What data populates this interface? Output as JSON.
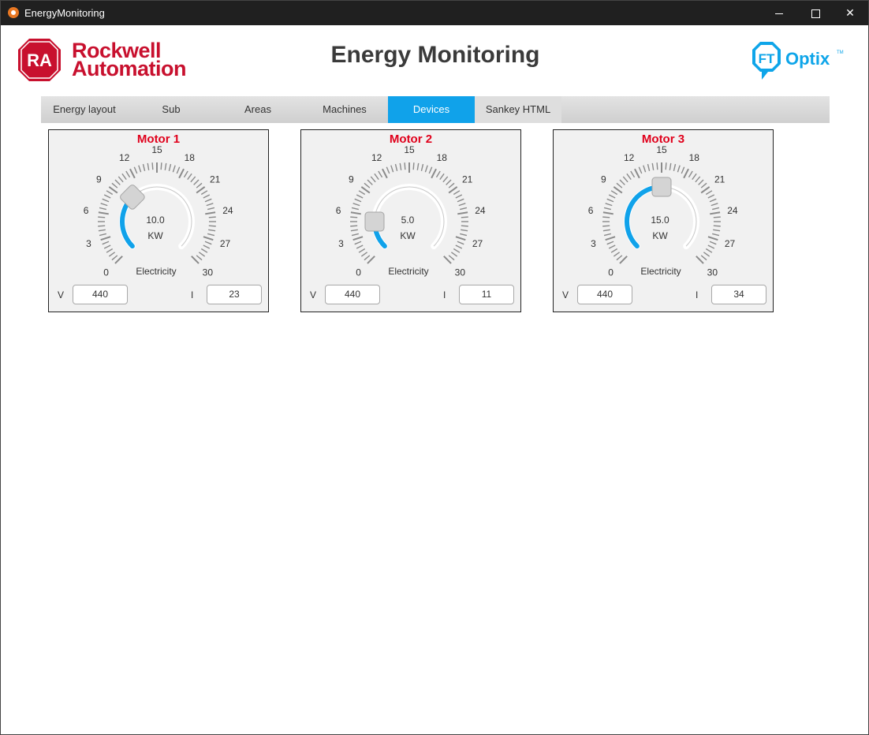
{
  "window": {
    "title": "EnergyMonitoring"
  },
  "header": {
    "brand_line1": "Rockwell",
    "brand_line2": "Automation",
    "brand_mark": "RA",
    "title": "Energy Monitoring",
    "ft_mark": "FT",
    "ft_name": "Optix",
    "ft_tm": "TM"
  },
  "tabs": [
    {
      "label": "Energy layout",
      "active": false
    },
    {
      "label": "Sub",
      "active": false
    },
    {
      "label": "Areas",
      "active": false
    },
    {
      "label": "Machines",
      "active": false
    },
    {
      "label": "Devices",
      "active": true
    },
    {
      "label": "Sankey HTML",
      "active": false
    }
  ],
  "gauge_scale": {
    "min": 0,
    "max": 30,
    "ticks": [
      "0",
      "3",
      "6",
      "9",
      "12",
      "15",
      "18",
      "21",
      "24",
      "27",
      "30"
    ]
  },
  "devices": [
    {
      "name": "Motor 1",
      "value": 10.0,
      "value_text": "10.0",
      "unit": "KW",
      "label": "Electricity",
      "v_label": "V",
      "v_value": "440",
      "i_label": "I",
      "i_value": "23"
    },
    {
      "name": "Motor 2",
      "value": 5.0,
      "value_text": "5.0",
      "unit": "KW",
      "label": "Electricity",
      "v_label": "V",
      "v_value": "440",
      "i_label": "I",
      "i_value": "11"
    },
    {
      "name": "Motor 3",
      "value": 15.0,
      "value_text": "15.0",
      "unit": "KW",
      "label": "Electricity",
      "v_label": "V",
      "v_value": "440",
      "i_label": "I",
      "i_value": "34"
    }
  ],
  "colors": {
    "brand_red": "#c8102e",
    "title_red": "#e0001b",
    "accent_blue": "#10a2ea",
    "ft_blue": "#0ea5e9"
  }
}
